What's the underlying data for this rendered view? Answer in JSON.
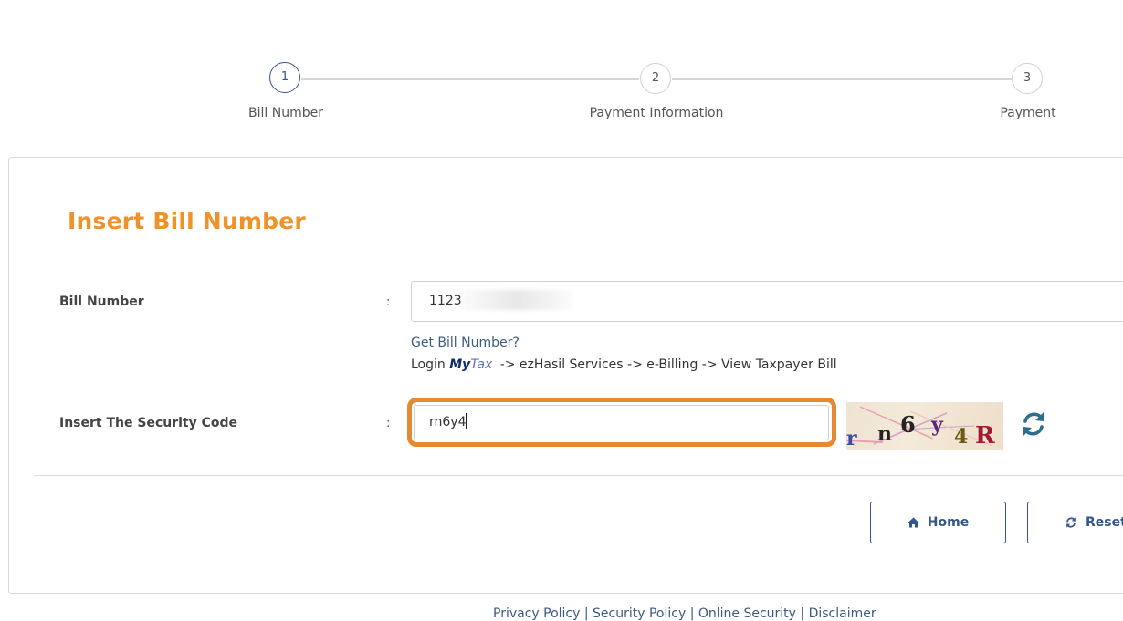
{
  "stepper": {
    "steps": [
      {
        "number": "1",
        "label": "Bill Number",
        "active": true
      },
      {
        "number": "2",
        "label": "Payment Information",
        "active": false
      },
      {
        "number": "3",
        "label": "Payment",
        "active": false
      }
    ]
  },
  "form": {
    "title": "Insert Bill Number",
    "bill_number": {
      "label": "Bill Number",
      "separator": ":",
      "value": "1123"
    },
    "help": {
      "link_text": "Get Bill Number?",
      "path_prefix": "Login",
      "logo_text_my": "My",
      "logo_text_tax": "Tax",
      "path_suffix": "-> ezHasil Services -> e-Billing -> View Taxpayer Bill"
    },
    "security_code": {
      "label": "Insert The Security Code",
      "separator": ":",
      "value": "rn6y4",
      "captcha_chars": [
        "r",
        "n",
        "6",
        "y",
        "4",
        "R"
      ]
    }
  },
  "buttons": {
    "home_label": "Home",
    "reset_label": "Reset"
  },
  "footer": {
    "links_text": "Privacy Policy | Security Policy | Online Security | Disclaimer"
  },
  "colors": {
    "accent_orange": "#f0922b",
    "highlight_orange": "#e58a32",
    "primary_blue": "#34558b"
  }
}
